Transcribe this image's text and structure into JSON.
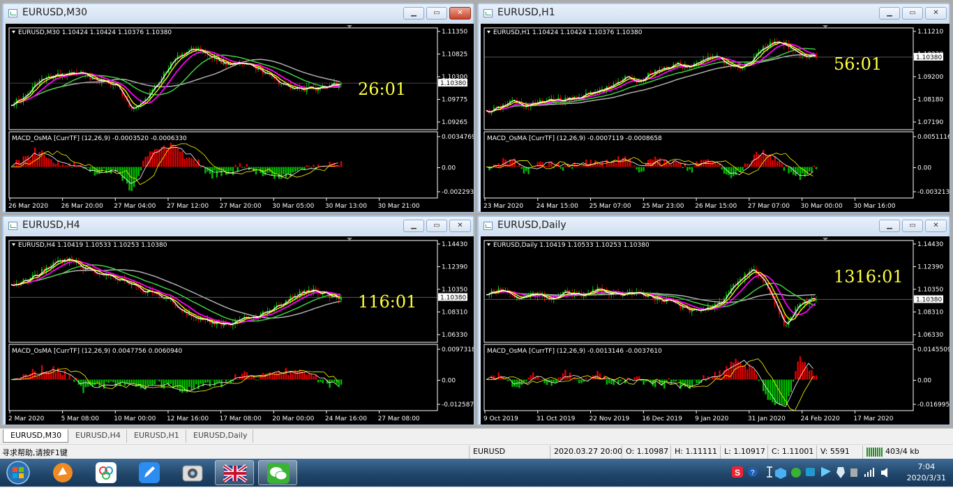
{
  "windows": [
    {
      "title": "EURUSD,M30",
      "info": "EURUSD,M30  1.10424 1.10424 1.10376 1.10380",
      "timer": "26:01",
      "macd": "MACD_OsMA [CurrTF] (12,26,9) -0.0003520 -0.0006330",
      "prices": [
        "1.11350",
        "1.10825",
        "1.10300",
        "1.09775",
        "1.09265"
      ],
      "current": "1.10380",
      "macd_scale": [
        "0.0034769",
        "0.00",
        "-0.002293"
      ],
      "times": [
        "26 Mar 2020",
        "26 Mar 20:00",
        "27 Mar 04:00",
        "27 Mar 12:00",
        "27 Mar 20:00",
        "30 Mar 05:00",
        "30 Mar 13:00",
        "30 Mar 21:00"
      ]
    },
    {
      "title": "EURUSD,H1",
      "info": "EURUSD,H1  1.10424 1.10424 1.10376 1.10380",
      "timer": "56:01",
      "macd": "MACD_OsMA [CurrTF] (12,26,9) -0.0007119 -0.0008658",
      "prices": [
        "1.11210",
        "1.10220",
        "1.09200",
        "1.08180",
        "1.07190"
      ],
      "current": "1.10380",
      "macd_scale": [
        "0.0051116",
        "0.00",
        "-0.003213"
      ],
      "times": [
        "23 Mar 2020",
        "24 Mar 15:00",
        "25 Mar 07:00",
        "25 Mar 23:00",
        "26 Mar 15:00",
        "27 Mar 07:00",
        "30 Mar 00:00",
        "30 Mar 16:00"
      ]
    },
    {
      "title": "EURUSD,H4",
      "info": "EURUSD,H4  1.10419 1.10533 1.10253 1.10380",
      "timer": "116:01",
      "macd": "MACD_OsMA [CurrTF] (12,26,9) 0.0047756 0.0060940",
      "prices": [
        "1.14430",
        "1.12390",
        "1.10350",
        "1.08310",
        "1.06330"
      ],
      "current": "1.10380",
      "macd_scale": [
        "0.0097318",
        "0.00",
        "-0.012587"
      ],
      "times": [
        "2 Mar 2020",
        "5 Mar 08:00",
        "10 Mar 00:00",
        "12 Mar 16:00",
        "17 Mar 08:00",
        "20 Mar 00:00",
        "24 Mar 16:00",
        "27 Mar 08:00"
      ]
    },
    {
      "title": "EURUSD,Daily",
      "info": "EURUSD,Daily  1.10419 1.10533 1.10253 1.10380",
      "timer": "1316:01",
      "macd": "MACD_OsMA [CurrTF] (12,26,9) -0.0013146 -0.0037610",
      "prices": [
        "1.14430",
        "1.12390",
        "1.10350",
        "1.08310",
        "1.06330"
      ],
      "current": "1.10380",
      "macd_scale": [
        "0.0145509",
        "0.00",
        "-0.016995"
      ],
      "times": [
        "9 Oct 2019",
        "31 Oct 2019",
        "22 Nov 2019",
        "16 Dec 2019",
        "9 Jan 2020",
        "31 Jan 2020",
        "24 Feb 2020",
        "17 Mar 2020"
      ]
    }
  ],
  "tabs": [
    "EURUSD,M30",
    "EURUSD,H4",
    "EURUSD,H1",
    "EURUSD,Daily"
  ],
  "status": {
    "help": "寻求帮助,请按F1键",
    "symbol": "EURUSD",
    "datetime": "2020.03.27 20:00",
    "open": "O: 1.10987",
    "high": "H: 1.11111",
    "low": "L: 1.10917",
    "close": "C: 1.11001",
    "volume": "V: 5591",
    "traffic": "403/4 kb"
  },
  "clock": {
    "time": "7:04",
    "date": "2020/3/31"
  },
  "colors": {
    "bull": "#00c000",
    "bear": "#e00000",
    "ma_fast": "#ffffff",
    "ma_mid": "#ffff00",
    "ma_slow": "#ff00ff",
    "ma_green": "#40d040",
    "ma_grey": "#b0b0b0",
    "timer": "#ffff40"
  }
}
